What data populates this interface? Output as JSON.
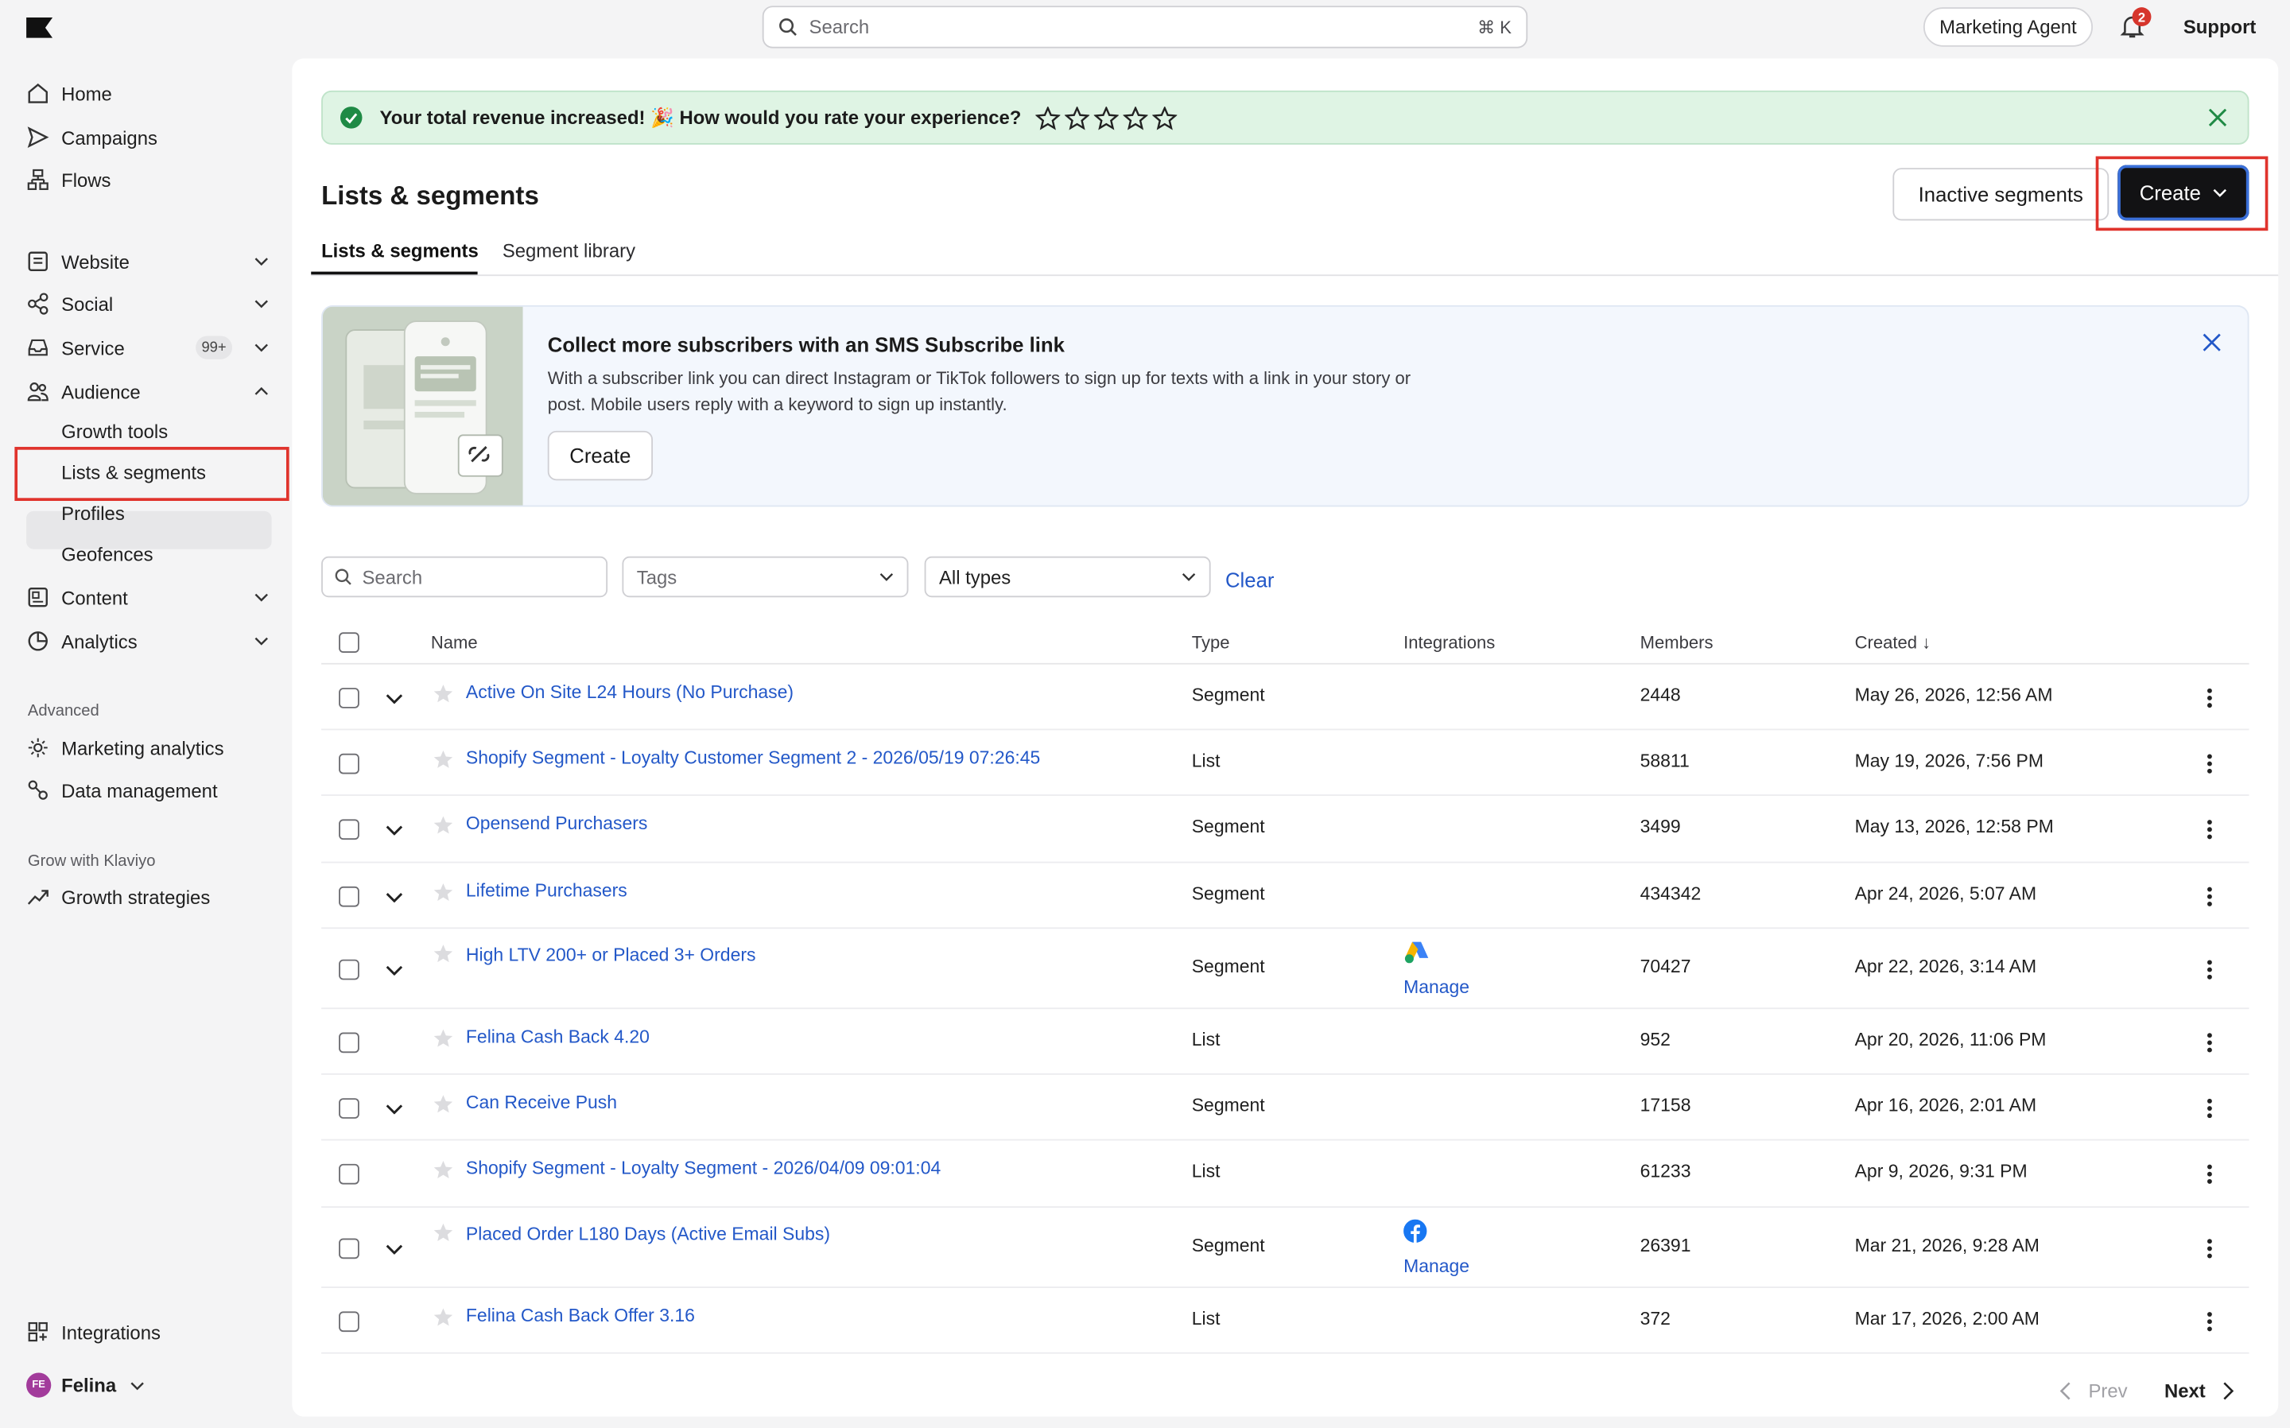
{
  "topbar": {
    "search_placeholder": "Search",
    "search_shortcut": "⌘ K",
    "agent_label": "Marketing Agent",
    "notification_count": "2",
    "support_label": "Support"
  },
  "sidebar": {
    "items": [
      {
        "label": "Home",
        "icon": "home-icon"
      },
      {
        "label": "Campaigns",
        "icon": "send-icon"
      },
      {
        "label": "Flows",
        "icon": "flow-icon"
      },
      {
        "label": "Website",
        "icon": "website-icon"
      },
      {
        "label": "Social",
        "icon": "social-icon"
      },
      {
        "label": "Service",
        "icon": "inbox-icon",
        "badge": "99+"
      },
      {
        "label": "Audience",
        "icon": "audience-icon"
      },
      {
        "label": "Content",
        "icon": "content-icon"
      },
      {
        "label": "Analytics",
        "icon": "analytics-icon"
      }
    ],
    "audience_sub": [
      "Growth tools",
      "Lists & segments",
      "Profiles",
      "Geofences"
    ],
    "advanced_label": "Advanced",
    "advanced_items": [
      "Marketing analytics",
      "Data management"
    ],
    "grow_label": "Grow with Klaviyo",
    "grow_items": [
      "Growth strategies"
    ],
    "integrations_label": "Integrations",
    "user_initials": "FE",
    "user_name": "Felina"
  },
  "toast": {
    "text": "Your total revenue increased! 🎉 How would you rate your experience?",
    "star_rating": 0,
    "star_count": 5
  },
  "page": {
    "title": "Lists & segments",
    "inactive_button": "Inactive segments",
    "create_button": "Create",
    "tabs": [
      "Lists & segments",
      "Segment library"
    ]
  },
  "promo": {
    "title": "Collect more subscribers with an SMS Subscribe link",
    "description": "With a subscriber link you can direct Instagram or TikTok followers to sign up for texts with a link in your story or post. Mobile users reply with a keyword to sign up instantly.",
    "button": "Create"
  },
  "filters": {
    "search_placeholder": "Search",
    "tags_placeholder": "Tags",
    "types_value": "All types",
    "clear_label": "Clear"
  },
  "table": {
    "headers": {
      "name": "Name",
      "type": "Type",
      "integrations": "Integrations",
      "members": "Members",
      "created": "Created ↓"
    },
    "rows": [
      {
        "name": "Active On Site L24 Hours (No Purchase)",
        "type": "Segment",
        "integration": "",
        "members": "2448",
        "created": "May 26, 2026, 12:56 AM",
        "expandable": true
      },
      {
        "name": "Shopify Segment - Loyalty Customer Segment 2 - 2026/05/19 07:26:45",
        "type": "List",
        "integration": "",
        "members": "58811",
        "created": "May 19, 2026, 7:56 PM",
        "expandable": false
      },
      {
        "name": "Opensend Purchasers",
        "type": "Segment",
        "integration": "",
        "members": "3499",
        "created": "May 13, 2026, 12:58 PM",
        "expandable": true
      },
      {
        "name": "Lifetime Purchasers",
        "type": "Segment",
        "integration": "",
        "members": "434342",
        "created": "Apr 24, 2026, 5:07 AM",
        "expandable": true
      },
      {
        "name": "High LTV 200+ or Placed 3+ Orders",
        "type": "Segment",
        "integration": "google-ads-icon",
        "members": "70427",
        "created": "Apr 22, 2026, 3:14 AM",
        "expandable": true
      },
      {
        "name": "Felina Cash Back 4.20",
        "type": "List",
        "integration": "",
        "members": "952",
        "created": "Apr 20, 2026, 11:06 PM",
        "expandable": false
      },
      {
        "name": "Can Receive Push",
        "type": "Segment",
        "integration": "",
        "members": "17158",
        "created": "Apr 16, 2026, 2:01 AM",
        "expandable": true
      },
      {
        "name": "Shopify Segment - Loyalty Segment - 2026/04/09 09:01:04",
        "type": "List",
        "integration": "",
        "members": "61233",
        "created": "Apr 9, 2026, 9:31 PM",
        "expandable": false
      },
      {
        "name": "Placed Order L180 Days (Active Email Subs)",
        "type": "Segment",
        "integration": "facebook-icon",
        "members": "26391",
        "created": "Mar 21, 2026, 9:28 AM",
        "expandable": true
      },
      {
        "name": "Felina Cash Back Offer 3.16",
        "type": "List",
        "integration": "",
        "members": "372",
        "created": "Mar 17, 2026, 2:00 AM",
        "expandable": false
      }
    ],
    "manage_label": "Manage"
  },
  "pager": {
    "prev": "Prev",
    "next": "Next"
  },
  "colors": {
    "link": "#2358c8",
    "highlight": "#e0332c",
    "toast_bg": "#dff4e4",
    "primary_button": "#121214"
  }
}
